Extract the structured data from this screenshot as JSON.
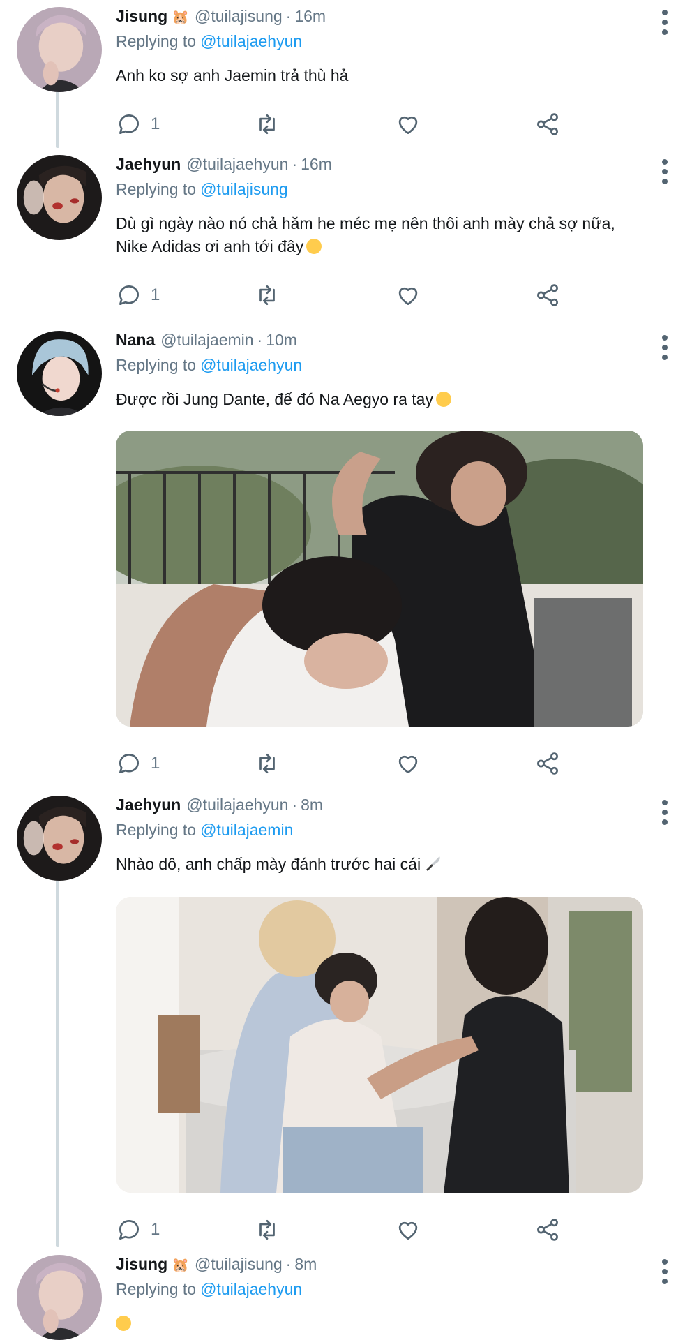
{
  "tweets": [
    {
      "name": "Jisung",
      "badge": "🐹",
      "handle": "@tuilajisung",
      "time": "16m",
      "replying_label": "Replying to",
      "replying_to": "@tuilajaehyun",
      "text": "Anh ko sợ anh Jaemin trả thù hả",
      "reply_count": "1"
    },
    {
      "name": "Jaehyun",
      "handle": "@tuilajaehyun",
      "time": "16m",
      "replying_label": "Replying to",
      "replying_to": "@tuilajisung",
      "text": "Dù gì ngày nào nó chả hăm he méc mẹ nên thôi anh mày chả sợ nữa, Nike Adidas ơi anh tới đây",
      "reply_count": "1"
    },
    {
      "name": "Nana",
      "handle": "@tuilajaemin",
      "time": "10m",
      "replying_label": "Replying to",
      "replying_to": "@tuilajaehyun",
      "text": "Được rồi Jung Dante, để đó Na Aegyo ra tay",
      "reply_count": "1"
    },
    {
      "name": "Jaehyun",
      "handle": "@tuilajaehyun",
      "time": "8m",
      "replying_label": "Replying to",
      "replying_to": "@tuilajaemin",
      "text": "Nhào dô, anh chấp mày đánh trước hai cái",
      "reply_count": "1"
    },
    {
      "name": "Jisung",
      "badge": "🐹",
      "handle": "@tuilajisung",
      "time": "8m",
      "replying_label": "Replying to",
      "replying_to": "@tuilajaehyun",
      "text": ""
    }
  ],
  "icons": {
    "reply": "comment-icon",
    "retweet": "retweet-icon",
    "like": "heart-icon",
    "share": "share-icon",
    "more": "more-vertical-icon"
  },
  "colors": {
    "link": "#1d9bf0",
    "secondary_text": "#657786",
    "thread_line": "#cfd9de"
  }
}
